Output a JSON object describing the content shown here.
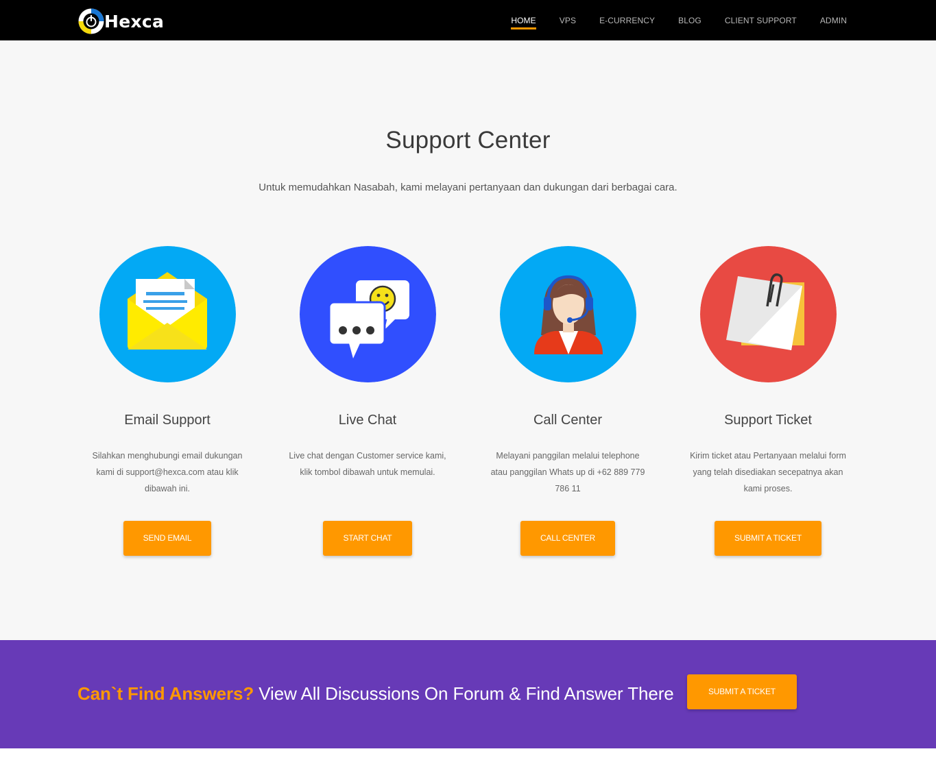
{
  "brand": {
    "name": "Hexca",
    "accent": "#ff9800"
  },
  "nav": {
    "items": [
      "HOME",
      "VPS",
      "E-CURRENCY",
      "BLOG",
      "CLIENT SUPPORT",
      "ADMIN"
    ],
    "active": "HOME"
  },
  "hero": {
    "title": "Support Center",
    "subtitle": "Untuk memudahkan Nasabah, kami melayani pertanyaan dan dukungan dari berbagai cara."
  },
  "cards": [
    {
      "icon": "envelope-icon",
      "color": "#03a9f4",
      "title": "Email Support",
      "description": "Silahkan menghubungi email dukungan kami di support@hexca.com atau klik dibawah ini.",
      "button": "SEND EMAIL"
    },
    {
      "icon": "chat-bubbles-icon",
      "color": "#304ffe",
      "title": "Live Chat",
      "description": "Live chat dengan Customer service kami, klik tombol dibawah untuk memulai.",
      "button": "START CHAT"
    },
    {
      "icon": "headset-agent-icon",
      "color": "#03a9f4",
      "title": "Call Center",
      "description": "Melayani panggilan melalui telephone atau panggilan Whats up di +62 889 779 786 11",
      "button": "CALL CENTER"
    },
    {
      "icon": "paperclip-note-icon",
      "color": "#e84a43",
      "title": "Support Ticket",
      "description": "Kirim ticket atau Pertanyaan melalui form yang telah disediakan secepatnya akan kami proses.",
      "button": "SUBMIT A TICKET"
    }
  ],
  "banner": {
    "highlight": "Can`t Find Answers?",
    "text": " View All Discussions On Forum & Find Answer There",
    "button": "SUBMIT A TICKET",
    "color": "#673ab7"
  }
}
